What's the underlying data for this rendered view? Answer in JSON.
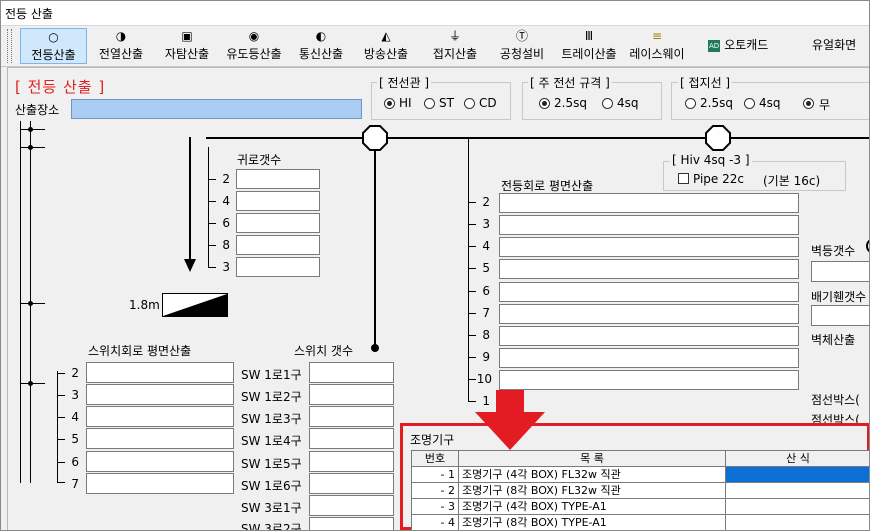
{
  "window": {
    "title": "전등 산출"
  },
  "toolbar": {
    "items": [
      {
        "label": "전등산출",
        "icon": "○"
      },
      {
        "label": "전열산출",
        "icon": "◑"
      },
      {
        "label": "자탐산출",
        "icon": "▣"
      },
      {
        "label": "유도등산출",
        "icon": "◉"
      },
      {
        "label": "통신산출",
        "icon": "◐"
      },
      {
        "label": "방송산출",
        "icon": "◭"
      },
      {
        "label": "접지산출",
        "icon": "⏚"
      },
      {
        "label": "공청설비",
        "icon": "Ⓣ"
      },
      {
        "label": "트레이산출",
        "icon": "Ⅲ"
      },
      {
        "label": "레이스웨이",
        "icon": "≡"
      }
    ],
    "autocad": "오토캐드",
    "autocad_icon": "AD",
    "dual": "유얼화면"
  },
  "page_title": "[ 전등 산출 ]",
  "location_label": "산출장소",
  "location_value": "",
  "conduit": {
    "title": "[ 전선관 ]",
    "options": [
      "HI",
      "ST",
      "CD"
    ],
    "selected": "HI"
  },
  "main_wire": {
    "title": "[ 주 전선 규격 ]",
    "options": [
      "2.5sq",
      "4sq"
    ],
    "selected": "2.5sq"
  },
  "ground_wire": {
    "title": "[ 접지선 ]",
    "options": [
      "2.5sq",
      "4sq",
      "무"
    ],
    "selected": "무"
  },
  "hiv": {
    "title": "[ Hiv 4sq -3 ]",
    "checkbox_label": "Pipe 22c",
    "note": "(기본 16c)",
    "checked": false
  },
  "return_circuit": {
    "title": "귀로갯수",
    "rows": [
      "2",
      "4",
      "6",
      "8",
      "3"
    ]
  },
  "scale_label": "1.8m",
  "lamp_plan": {
    "title": "전등회로 평면산출",
    "rows": [
      "2",
      "3",
      "4",
      "5",
      "6",
      "7",
      "8",
      "9",
      "10",
      "1"
    ]
  },
  "right_labels": [
    "벽등갯수",
    "배기휀갯수",
    "벽체산출",
    "점선박스(",
    "점선박스("
  ],
  "switch_plan": {
    "title": "스위치회로 평면산출",
    "rows": [
      "2",
      "3",
      "4",
      "5",
      "6",
      "7"
    ]
  },
  "switch_count": {
    "title": "스위치 갯수",
    "rows": [
      "SW 1로1구",
      "SW 1로2구",
      "SW 1로3구",
      "SW 1로4구",
      "SW 1로5구",
      "SW 1로6구",
      "SW 3로1구",
      "SW 3로2구"
    ]
  },
  "fixtures": {
    "title": "조명기구",
    "headers": [
      "번호",
      "목    록",
      "산    식"
    ],
    "rows": [
      {
        "no": "- 1",
        "name": "조명기구 (4각 BOX) FL32w 직관"
      },
      {
        "no": "- 2",
        "name": "조명기구 (8각 BOX) FL32w 직관"
      },
      {
        "no": "- 3",
        "name": "조명기구 (4각 BOX) TYPE-A1"
      },
      {
        "no": "- 4",
        "name": "조명기구 (8각 BOX) TYPE-A1"
      }
    ]
  },
  "colors": {
    "accent_red": "#e31b23",
    "selection_blue": "#0b6fd6",
    "location_field": "#a9cdf2"
  }
}
